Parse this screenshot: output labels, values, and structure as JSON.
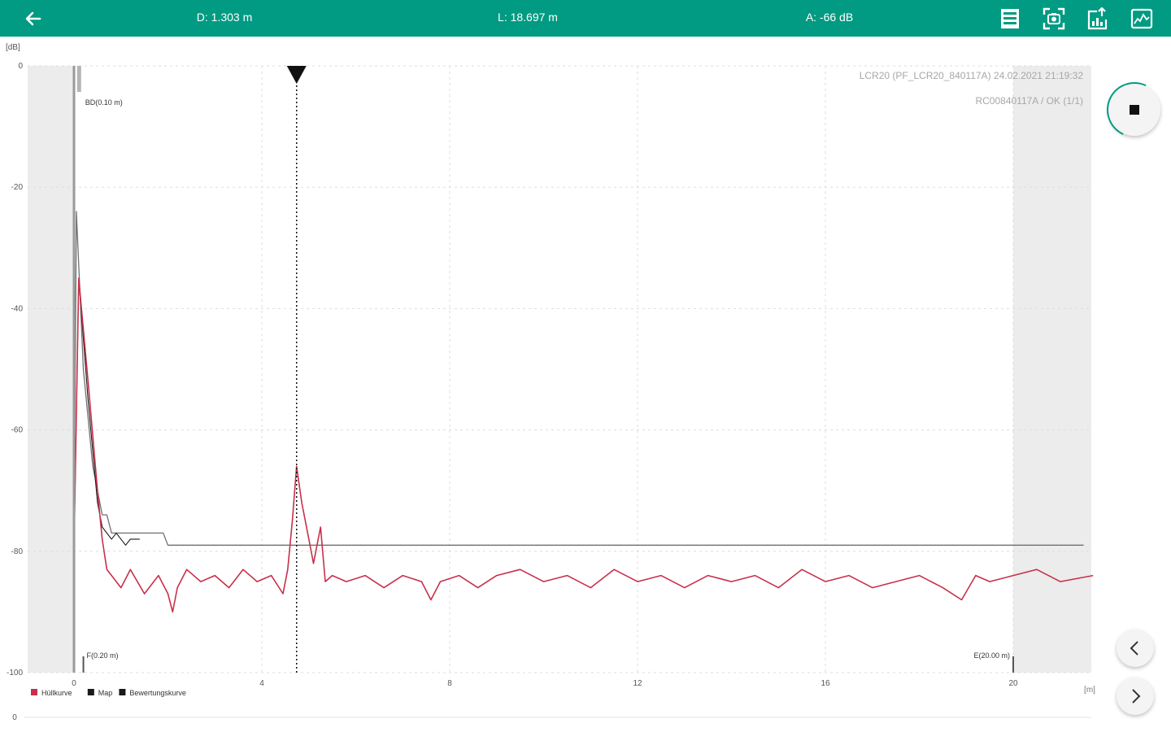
{
  "header": {
    "distance": "D: 1.303 m",
    "length": "L: 18.697 m",
    "amplitude": "A: -66 dB",
    "icons": [
      "table-icon",
      "snapshot-icon",
      "export-icon",
      "curve-icon"
    ]
  },
  "colors": {
    "accent": "#009b82",
    "envelope": "#c8304a",
    "map": "#1a1a1a",
    "evaluation": "#707070",
    "blocking_zone": "#ececec"
  },
  "buttons": {
    "stop_icon": "stop-icon",
    "prev_icon": "chevron-left-icon",
    "next_icon": "chevron-right-icon"
  },
  "chart_data": {
    "type": "line",
    "ylabel": "[dB]",
    "xlabel": "[m]",
    "xlim": [
      0,
      20
    ],
    "ylim": [
      -100,
      0
    ],
    "bottom_axis_label": "0",
    "x_ticks": [
      0,
      4,
      8,
      12,
      16,
      20
    ],
    "y_ticks": [
      0,
      -20,
      -40,
      -60,
      -80,
      -100
    ],
    "grid": true,
    "info_line_1": "LCR20 (PF_LCR20_840117A) 24.02.2021 21:19:32",
    "info_line_2": "RC00840117A / OK (1/1)",
    "blocking_zone_start": [
      -1,
      0
    ],
    "blocking_zone_end": [
      20,
      21.7
    ],
    "markers": [
      {
        "label": "BD(0.10 m)",
        "x": 0.1
      },
      {
        "label": "F(0.20 m)",
        "x": 0.2
      },
      {
        "label": "E(20.00 m)",
        "x": 20.0
      }
    ],
    "cursor": {
      "x": 4.74
    },
    "legend": [
      {
        "name": "Hüllkurve",
        "color": "#c8304a"
      },
      {
        "name": "Map",
        "color": "#1a1a1a"
      },
      {
        "name": "Bewertungskurve",
        "color": "#1a1a1a"
      }
    ],
    "series": [
      {
        "name": "Hüllkurve",
        "x": [
          0,
          0.1,
          0.3,
          0.5,
          0.6,
          0.7,
          0.8,
          1.0,
          1.2,
          1.5,
          1.8,
          2.0,
          2.1,
          2.2,
          2.4,
          2.7,
          3.0,
          3.3,
          3.6,
          3.9,
          4.2,
          4.45,
          4.55,
          4.65,
          4.74,
          4.85,
          5.0,
          5.1,
          5.25,
          5.35,
          5.5,
          5.8,
          6.2,
          6.6,
          7.0,
          7.4,
          7.6,
          7.8,
          8.2,
          8.6,
          9.0,
          9.5,
          10.0,
          10.5,
          11.0,
          11.5,
          12.0,
          12.5,
          13.0,
          13.5,
          14.0,
          14.5,
          15.0,
          15.5,
          16.0,
          16.5,
          17.0,
          17.5,
          18.0,
          18.5,
          18.9,
          19.2,
          19.5,
          20.0,
          20.5,
          21.0,
          21.7
        ],
        "values": [
          -80,
          -35,
          -52,
          -70,
          -78,
          -83,
          -84,
          -86,
          -83,
          -87,
          -84,
          -87,
          -90,
          -86,
          -83,
          -85,
          -84,
          -86,
          -83,
          -85,
          -84,
          -87,
          -83,
          -75,
          -66,
          -72,
          -78,
          -82,
          -76,
          -85,
          -84,
          -85,
          -84,
          -86,
          -84,
          -85,
          -88,
          -85,
          -84,
          -86,
          -84,
          -83,
          -85,
          -84,
          -86,
          -83,
          -85,
          -84,
          -86,
          -84,
          -85,
          -84,
          -86,
          -83,
          -85,
          -84,
          -86,
          -85,
          -84,
          -86,
          -88,
          -84,
          -85,
          -84,
          -83,
          -85,
          -84
        ]
      },
      {
        "name": "Map",
        "x": [
          0,
          0.1,
          0.3,
          0.5,
          0.6,
          0.8,
          0.9,
          1.0,
          1.1,
          1.2,
          1.4
        ],
        "values": [
          -80,
          -35,
          -55,
          -72,
          -76,
          -78,
          -77,
          -78,
          -79,
          -78,
          -78
        ]
      },
      {
        "name": "Bewertungskurve",
        "x": [
          0,
          0.05,
          0.2,
          0.4,
          0.6,
          0.7,
          0.8,
          0.9,
          1.9,
          2.0,
          21.5
        ],
        "values": [
          -80,
          -24,
          -50,
          -66,
          -74,
          -74,
          -77,
          -77,
          -77,
          -79,
          -79
        ]
      }
    ]
  }
}
